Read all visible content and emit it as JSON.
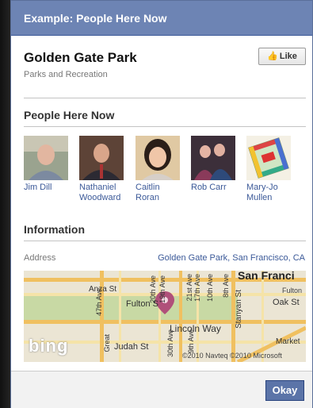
{
  "dialog": {
    "title": "Example: People Here Now"
  },
  "place": {
    "name": "Golden Gate Park",
    "category": "Parks and Recreation",
    "like_label": "Like"
  },
  "people_section": {
    "title": "People Here Now",
    "people": [
      {
        "first": "Jim Dill",
        "second": ""
      },
      {
        "first": "Nathaniel",
        "second": "Woodward"
      },
      {
        "first": "Caitlin",
        "second": "Roran"
      },
      {
        "first": "Rob Carr",
        "second": ""
      },
      {
        "first": "Mary-Jo",
        "second": "Mullen"
      }
    ]
  },
  "info_section": {
    "title": "Information",
    "address_label": "Address",
    "address_value": "Golden Gate Park, San Francisco, CA"
  },
  "map": {
    "streets": {
      "anza": "Anza St",
      "fulton": "Fulton S",
      "lincoln": "Lincoln Way",
      "judah": "Judah St",
      "oak": "Oak St",
      "stanyan": "Stanyan St",
      "fulton_right": "Fulton",
      "market": "Market",
      "ave_47": "47th Ave",
      "ave_20": "20th Ave",
      "ave_19": "19th Ave",
      "ave_30": "30th Ave",
      "ave_10": "10th Ave",
      "ave_9": "9th Ave",
      "ave_8": "8th Ave",
      "ave_17": "17th Ave",
      "ave_21": "21st Ave",
      "great": "Great"
    },
    "city_label": "San Franci",
    "brand": "bing",
    "copyright": "©2010 Navteq ©2010 Microsoft"
  },
  "footer": {
    "okay_label": "Okay"
  },
  "colors": {
    "title_bar": "#6d84b4",
    "link": "#3b5998",
    "map_pin": "#b0507a",
    "map_road": "#f0c060",
    "map_park": "#c8d9a4"
  }
}
